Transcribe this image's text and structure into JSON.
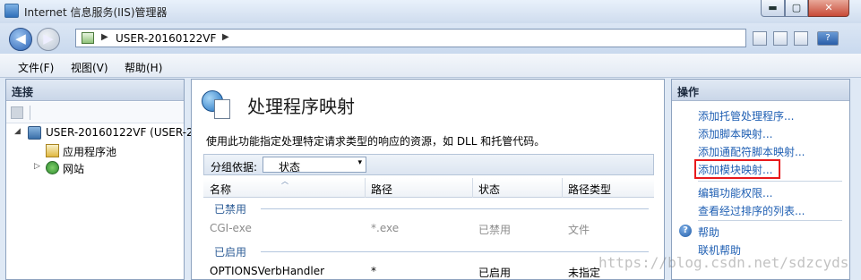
{
  "window": {
    "title": "Internet 信息服务(IIS)管理器",
    "min_glyph": "▬",
    "max_glyph": "▢",
    "close_glyph": "✕"
  },
  "nav": {
    "back_glyph": "◀",
    "forward_glyph": "▶",
    "breadcrumb": "USER-20160122VF",
    "crumb_sep": "▶",
    "tool_icons": [
      "refresh-icon",
      "stop-icon",
      "home-icon",
      "help-icon"
    ],
    "help_glyph": "?"
  },
  "menu": {
    "items": [
      "文件(F)",
      "视图(V)",
      "帮助(H)"
    ]
  },
  "connections": {
    "title": "连接",
    "tree": [
      {
        "label": "USER-20160122VF (USER-2",
        "expander": "◢",
        "icon": "server-icon"
      },
      {
        "label": "应用程序池",
        "expander": "",
        "icon": "app-pool-icon"
      },
      {
        "label": "网站",
        "expander": "▷",
        "icon": "sites-icon"
      }
    ]
  },
  "feature": {
    "title": "处理程序映射",
    "description": "使用此功能指定处理特定请求类型的响应的资源，如 DLL 和托管代码。",
    "group_by_label": "分组依据:",
    "group_by_value": "状态",
    "dropdown_glyph": "▾",
    "columns": [
      "名称",
      "路径",
      "状态",
      "路径类型"
    ],
    "groups": [
      {
        "label": "已禁用",
        "rows": [
          {
            "name": "CGI-exe",
            "path": "*.exe",
            "state": "已禁用",
            "path_type": "文件"
          }
        ]
      },
      {
        "label": "已启用",
        "rows": [
          {
            "name": "OPTIONSVerbHandler",
            "path": "*",
            "state": "已启用",
            "path_type": "未指定"
          }
        ]
      }
    ]
  },
  "actions": {
    "title": "操作",
    "items": [
      "添加托管处理程序...",
      "添加脚本映射...",
      "添加通配符脚本映射...",
      "添加模块映射...",
      "编辑功能权限...",
      "查看经过排序的列表..."
    ],
    "help_glyph": "?",
    "help": "帮助",
    "online_help": "联机帮助",
    "highlight_color": "#e8191c"
  },
  "watermark": "https://blog.csdn.net/sdzcyds"
}
